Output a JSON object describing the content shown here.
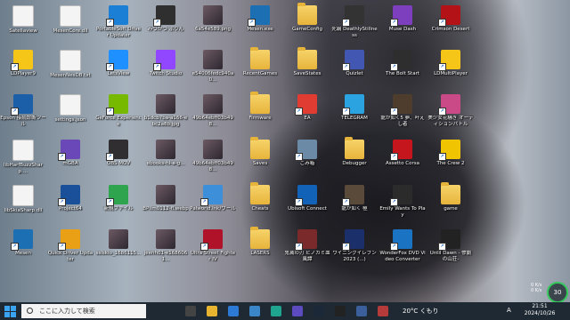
{
  "desktop": {
    "icons": [
      {
        "label": "Satellaview",
        "kind": "file"
      },
      {
        "label": "LDPlayer9",
        "kind": "app",
        "color": "#f5c518"
      },
      {
        "label": "Epson 接続診断ツール",
        "kind": "app",
        "color": "#1b5fa8"
      },
      {
        "label": "libHarfBuzzSharp....",
        "kind": "file"
      },
      {
        "label": "libSkiaSharp.dll",
        "kind": "file"
      },
      {
        "label": "Mesen",
        "kind": "app",
        "color": "#1c6fb3"
      },
      {
        "label": "MesenCore.dll",
        "kind": "file"
      },
      {
        "label": "MesenNesDB.txt",
        "kind": "file"
      },
      {
        "label": "settings.json",
        "kind": "file"
      },
      {
        "label": "mGBA",
        "kind": "app",
        "color": "#6a48b8"
      },
      {
        "label": "Project64",
        "kind": "app",
        "color": "#1a4f9a"
      },
      {
        "label": "Quick Driver Updater",
        "kind": "app",
        "color": "#e9a014"
      },
      {
        "label": "PortableSoft Driver Updater",
        "kind": "app",
        "color": "#1b7fd6"
      },
      {
        "label": "LetsView",
        "kind": "app",
        "color": "#1e90ff"
      },
      {
        "label": "GeForce Experience",
        "kind": "app",
        "color": "#76b900"
      },
      {
        "label": "OBS MOV",
        "kind": "app",
        "color": "#302e31"
      },
      {
        "label": "新規ファイル",
        "kind": "app",
        "color": "#2ea44f"
      },
      {
        "label": "sslskio_1686115...",
        "kind": "photo"
      },
      {
        "label": "みつかつ ぷりん",
        "kind": "app",
        "color": "#2f2f2f"
      },
      {
        "label": "Twitch Studio",
        "kind": "app",
        "color": "#9146ff"
      },
      {
        "label": "b1dcb7ba-a166-ebc2a8b.jpg",
        "kind": "photo"
      },
      {
        "label": "ebooks-hi-a-g...",
        "kind": "photo"
      },
      {
        "label": "BPlim0112-fl.webp",
        "kind": "photo"
      },
      {
        "label": "jeenh01-e1686061...",
        "kind": "photo"
      },
      {
        "label": "6a54e589.png",
        "kind": "photo"
      },
      {
        "label": "e54006fedc940a0...",
        "kind": "photo"
      },
      {
        "label": "49b64ebff03b498...",
        "kind": "photo"
      },
      {
        "label": "49b64ebff03b498...",
        "kind": "photo"
      },
      {
        "label": "Palworld.lnk/ワール",
        "kind": "app",
        "color": "#3d8fd9"
      },
      {
        "label": "Ultra Street Fighter IV",
        "kind": "app",
        "color": "#b0122a"
      },
      {
        "label": "Mesen.exe",
        "kind": "app",
        "color": "#1c6fb3"
      },
      {
        "label": "RecentGames",
        "kind": "folder"
      },
      {
        "label": "Firmware",
        "kind": "folder"
      },
      {
        "label": "Saves",
        "kind": "folder"
      },
      {
        "label": "Cheats",
        "kind": "folder"
      },
      {
        "label": "LASERS",
        "kind": "folder"
      },
      {
        "label": "GameConfig",
        "kind": "folder"
      },
      {
        "label": "SaveStates",
        "kind": "folder"
      },
      {
        "label": "EA",
        "kind": "app",
        "color": "#e03c31"
      },
      {
        "label": "ごみ箱",
        "kind": "app",
        "color": "#6b8aa5"
      },
      {
        "label": "Ubisoft Connect",
        "kind": "app",
        "color": "#1262b8"
      },
      {
        "label": "鬼滅の刃 ヒノカミ血風譚",
        "kind": "app",
        "color": "#7a2a2a"
      },
      {
        "label": "死霸 DeathlyStillness",
        "kind": "app",
        "color": "#333"
      },
      {
        "label": "Quizlet",
        "kind": "app",
        "color": "#4257b2"
      },
      {
        "label": "TELEGRAM",
        "kind": "app",
        "color": "#2aa3e0"
      },
      {
        "label": "Debugger",
        "kind": "folder"
      },
      {
        "label": "龍が如く 極",
        "kind": "app",
        "color": "#5a4a3a"
      },
      {
        "label": "ウイニングイレブン 2023 (...)",
        "kind": "app",
        "color": "#1b2f6b"
      },
      {
        "label": "Muse Dash",
        "kind": "app",
        "color": "#7e3fbf"
      },
      {
        "label": "The Bolt Start",
        "kind": "app",
        "color": "#2e2e2e"
      },
      {
        "label": "龍が如く5 夢、叶えし者",
        "kind": "app",
        "color": "#4e3d2c"
      },
      {
        "label": "Assetto Corsa",
        "kind": "app",
        "color": "#c4161c"
      },
      {
        "label": "Emily Wants To Play",
        "kind": "app",
        "color": "#2b2b2b"
      },
      {
        "label": "WonderFox DVD Video Converter",
        "kind": "app",
        "color": "#1b73c4"
      },
      {
        "label": "Crimson Desert",
        "kind": "app",
        "color": "#b31217"
      },
      {
        "label": "LDMultiPlayer",
        "kind": "app",
        "color": "#f5c518"
      },
      {
        "label": "美少女花騒ぎ オーディションバトル",
        "kind": "app",
        "color": "#c94a86"
      },
      {
        "label": "The Crew 2",
        "kind": "app",
        "color": "#f0c400"
      },
      {
        "label": "game",
        "kind": "folder"
      },
      {
        "label": "Until Dawn - 惨劇の山荘-",
        "kind": "app",
        "color": "#222"
      }
    ]
  },
  "taskbar": {
    "search_placeholder": "ここに入力して検索",
    "apps": [
      {
        "name": "task-view",
        "color": "#444"
      },
      {
        "name": "file-explorer",
        "color": "#e8b430"
      },
      {
        "name": "store",
        "color": "#2d7ad6"
      },
      {
        "name": "photos",
        "color": "#3a86c8"
      },
      {
        "name": "edge",
        "color": "#1fa48f"
      },
      {
        "name": "media",
        "color": "#5b4bbf"
      },
      {
        "name": "steam",
        "color": "#1b2838"
      },
      {
        "name": "obs",
        "color": "#222"
      },
      {
        "name": "app-9",
        "color": "#3a5f9a"
      },
      {
        "name": "app-10",
        "color": "#b53a3a"
      }
    ],
    "weather": "20°C くもり",
    "ime": "A",
    "time": "21:51",
    "date": "2024/10/26"
  },
  "widget": {
    "value": "30",
    "up": "0 K/s",
    "down": "0 K/s"
  }
}
